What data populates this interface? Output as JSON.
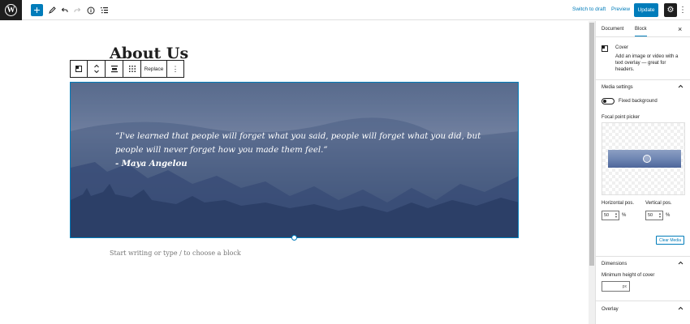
{
  "topbar": {
    "logo": "W",
    "add_label": "+",
    "icons": [
      "pen-icon",
      "undo-icon",
      "redo-icon",
      "info-icon",
      "list-view-icon"
    ],
    "switch_to_draft": "Switch to draft",
    "preview": "Preview",
    "update": "Update",
    "settings_glyph": "⚙",
    "more_glyph": "⋮"
  },
  "editor": {
    "page_title": "About Us",
    "toolbar": {
      "replace": "Replace",
      "more": "⋮"
    },
    "cover": {
      "quote_line1": "“I've learned that people will forget what you said, people will forget what you did, but",
      "quote_line2": "people will never forget how you made them feel.”",
      "author": "- Maya Angelou",
      "inserter": "+"
    },
    "placeholder": "Start writing or type / to choose a block"
  },
  "sidebar": {
    "tabs": [
      "Document",
      "Block"
    ],
    "active_tab": "Block",
    "close": "×",
    "block_card": {
      "title": "Cover",
      "description": "Add an image or video with a text overlay — great for headers."
    },
    "media_settings": {
      "title": "Media settings",
      "fixed_background_label": "Fixed background",
      "fixed_background_on": false,
      "focal_point_label": "Focal point picker",
      "horizontal_label": "Horizontal pos.",
      "horizontal_value": "50",
      "vertical_label": "Vertical pos.",
      "vertical_value": "50",
      "percent": "%",
      "clear_media": "Clear Media"
    },
    "dimensions": {
      "title": "Dimensions",
      "min_height_label": "Minimum height of cover",
      "unit": "px"
    },
    "overlay": {
      "title": "Overlay"
    }
  },
  "colors": {
    "accent": "#007cba",
    "dark": "#1e1e1e",
    "border": "#e0e0e0"
  }
}
